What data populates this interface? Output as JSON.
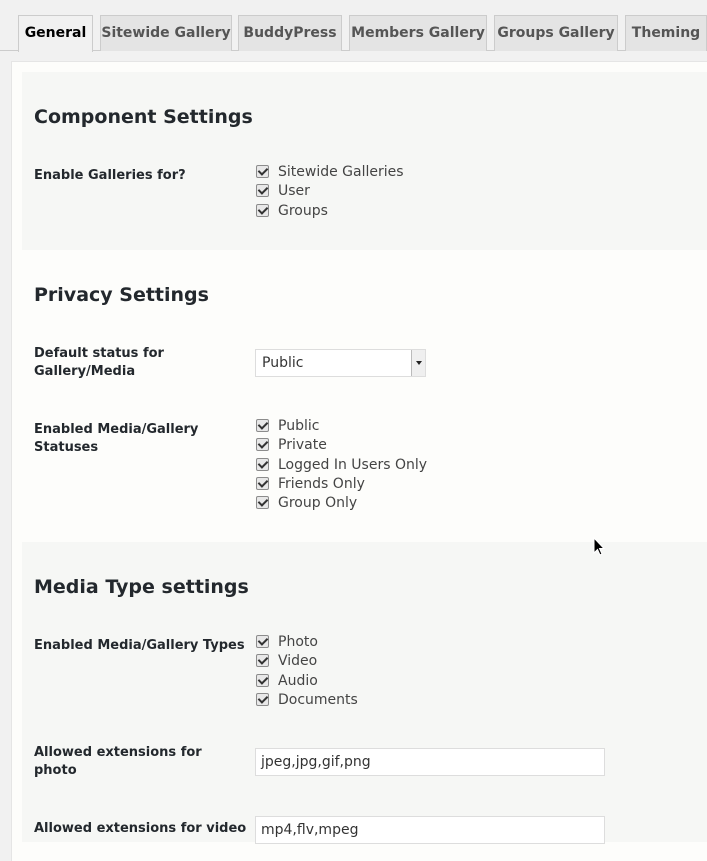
{
  "tabs": [
    {
      "label": "General",
      "active": true
    },
    {
      "label": "Sitewide Gallery",
      "active": false
    },
    {
      "label": "BuddyPress",
      "active": false
    },
    {
      "label": "Members Gallery",
      "active": false
    },
    {
      "label": "Groups Gallery",
      "active": false
    },
    {
      "label": "Theming",
      "active": false
    }
  ],
  "component_settings": {
    "title": "Component Settings",
    "enable_galleries": {
      "label": "Enable Galleries for?",
      "options": [
        {
          "label": "Sitewide Galleries",
          "checked": true
        },
        {
          "label": "User",
          "checked": true
        },
        {
          "label": "Groups",
          "checked": true
        }
      ]
    }
  },
  "privacy_settings": {
    "title": "Privacy Settings",
    "default_status": {
      "label": "Default status for Gallery/Media",
      "value": "Public"
    },
    "enabled_statuses": {
      "label": "Enabled Media/Gallery Statuses",
      "options": [
        {
          "label": "Public",
          "checked": true
        },
        {
          "label": "Private",
          "checked": true
        },
        {
          "label": "Logged In Users Only",
          "checked": true
        },
        {
          "label": "Friends Only",
          "checked": true
        },
        {
          "label": "Group Only",
          "checked": true
        }
      ]
    }
  },
  "media_type_settings": {
    "title": "Media Type settings",
    "enabled_types": {
      "label": "Enabled Media/Gallery Types",
      "options": [
        {
          "label": "Photo",
          "checked": true
        },
        {
          "label": "Video",
          "checked": true
        },
        {
          "label": "Audio",
          "checked": true
        },
        {
          "label": "Documents",
          "checked": true
        }
      ]
    },
    "photo_extensions": {
      "label": "Allowed extensions for photo",
      "value": "jpeg,jpg,gif,png"
    },
    "video_extensions": {
      "label": "Allowed extensions for video",
      "value": "mp4,flv,mpeg"
    }
  }
}
